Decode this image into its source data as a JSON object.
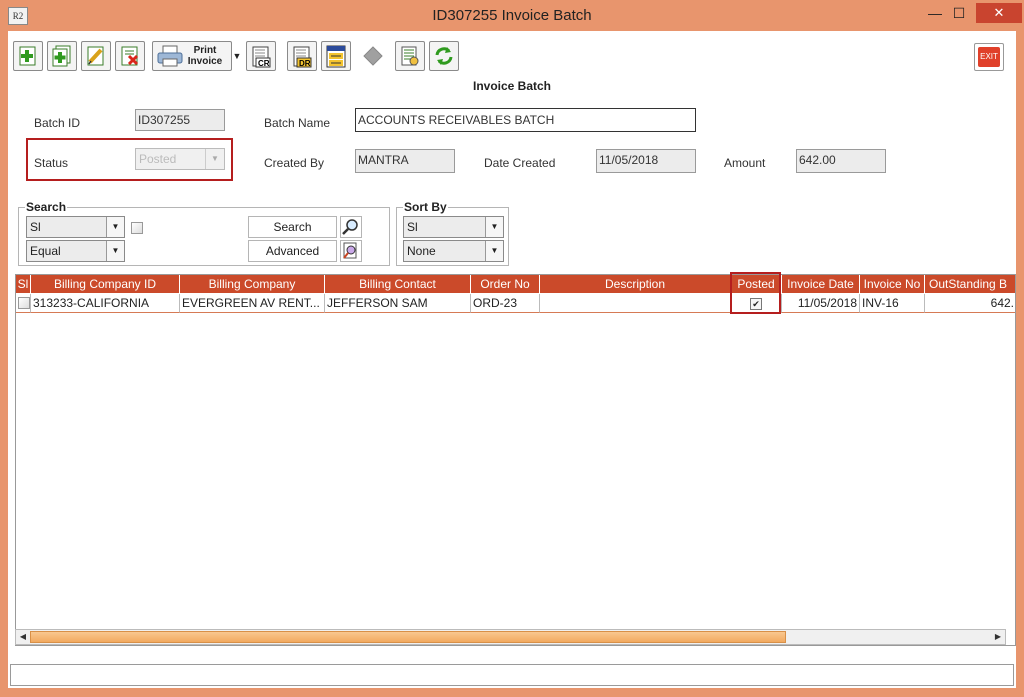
{
  "window": {
    "title": "ID307255 Invoice Batch",
    "app_icon_text": "R2",
    "minimize": "—",
    "maximize": "☐",
    "close": "✕"
  },
  "toolbar": {
    "print_label_1": "Print",
    "print_label_2": "Invoice",
    "exit_label": "EXIT",
    "dr_label": "DR",
    "cr_label": "CR"
  },
  "form": {
    "heading": "Invoice Batch",
    "batch_id_label": "Batch ID",
    "batch_id_value": "ID307255",
    "batch_name_label": "Batch Name",
    "batch_name_value": "ACCOUNTS RECEIVABLES BATCH",
    "status_label": "Status",
    "status_value": "Posted",
    "created_by_label": "Created By",
    "created_by_value": "MANTRA",
    "date_created_label": "Date Created",
    "date_created_value": "11/05/2018",
    "amount_label": "Amount",
    "amount_value": "642.00"
  },
  "search": {
    "title": "Search",
    "field_value": "Sl",
    "operator_value": "Equal",
    "search_button": "Search",
    "advanced_button": "Advanced"
  },
  "sort": {
    "title": "Sort By",
    "field_value": "Sl",
    "order_value": "None"
  },
  "grid": {
    "headers": [
      "Sl",
      "Billing Company ID",
      "Billing Company",
      "Billing Contact",
      "Order No",
      "Description",
      "Posted",
      "Invoice Date",
      "Invoice No",
      "OutStanding B"
    ],
    "rows": [
      {
        "company_id": "313233-CALIFORNIA",
        "company": "EVERGREEN AV RENT...",
        "contact": "JEFFERSON SAM",
        "order_no": "ORD-23",
        "description": "",
        "posted": true,
        "invoice_date": "11/05/2018",
        "invoice_no": "INV-16",
        "outstanding": "642."
      }
    ]
  },
  "colors": {
    "title_bar": "#E8956D",
    "header": "#CB4A2A",
    "highlight": "#B51E1E"
  }
}
